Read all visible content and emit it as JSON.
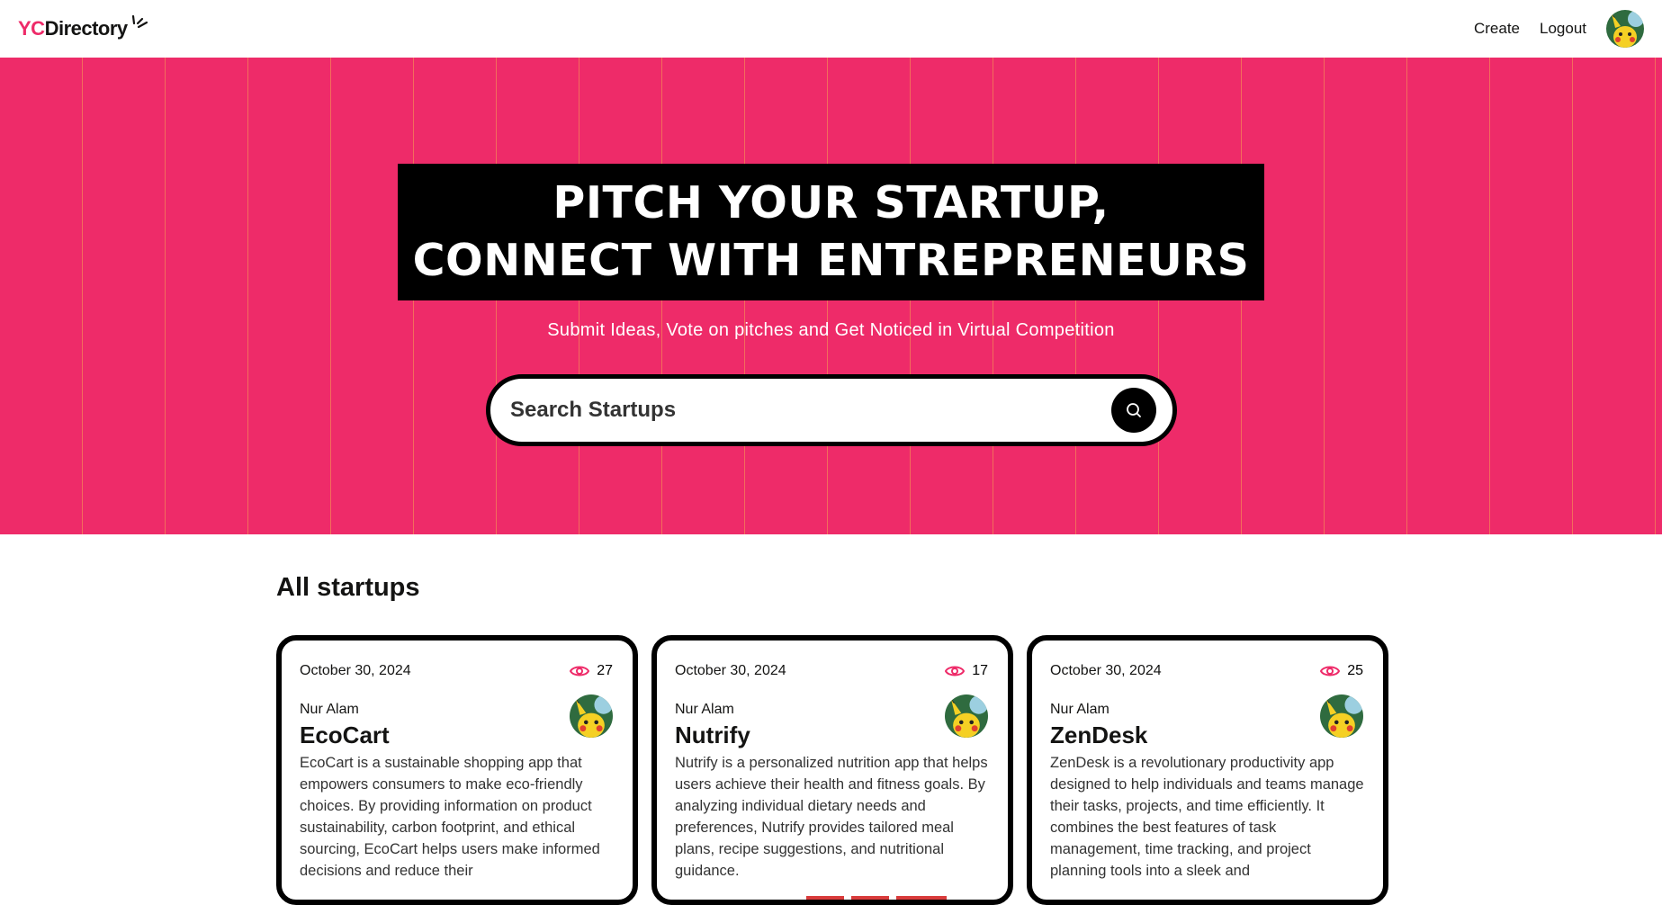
{
  "navbar": {
    "logo_yc": "YC",
    "logo_directory": "Directory",
    "create_label": "Create",
    "logout_label": "Logout"
  },
  "hero": {
    "title_line1": "PITCH YOUR STARTUP,",
    "title_line2": "CONNECT WITH ENTREPRENEURS",
    "subtitle": "Submit Ideas, Vote on pitches and Get Noticed in Virtual Competition",
    "search_placeholder": "Search Startups"
  },
  "section": {
    "title": "All startups"
  },
  "startups": [
    {
      "date": "October 30, 2024",
      "views": "27",
      "author": "Nur Alam",
      "name": "EcoCart",
      "description": "EcoCart is a sustainable shopping app that empowers consumers to make eco-friendly choices. By providing information on product sustainability, carbon footprint, and ethical sourcing, EcoCart helps users make informed decisions and reduce their"
    },
    {
      "date": "October 30, 2024",
      "views": "17",
      "author": "Nur Alam",
      "name": "Nutrify",
      "description": "Nutrify is a personalized nutrition app that helps users achieve their health and fitness goals. By analyzing individual dietary needs and preferences, Nutrify provides tailored meal plans, recipe suggestions, and nutritional guidance."
    },
    {
      "date": "October 30, 2024",
      "views": "25",
      "author": "Nur Alam",
      "name": "ZenDesk",
      "description": "ZenDesk is a revolutionary productivity app designed to help individuals and teams manage their tasks, projects, and time efficiently. It combines the best features of task management, time tracking, and project planning tools into a sleek and"
    }
  ],
  "colors": {
    "primary": "#EE2B69",
    "black": "#000000",
    "text": "#141413"
  }
}
